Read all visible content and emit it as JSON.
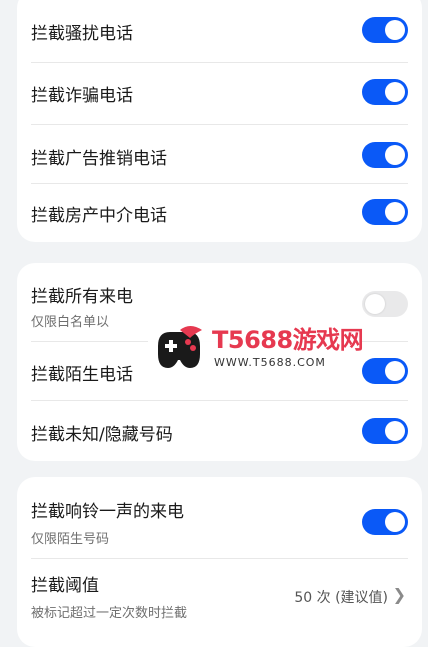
{
  "group1": {
    "items": [
      {
        "label": "拦截骚扰电话",
        "on": true
      },
      {
        "label": "拦截诈骗电话",
        "on": true
      },
      {
        "label": "拦截广告推销电话",
        "on": true
      },
      {
        "label": "拦截房产中介电话",
        "on": true
      }
    ]
  },
  "group2": {
    "items": [
      {
        "label": "拦截所有来电",
        "sub": "仅限白名单以",
        "on": false
      },
      {
        "label": "拦截陌生电话",
        "on": true
      },
      {
        "label": "拦截未知/隐藏号码",
        "on": true
      }
    ]
  },
  "group3": {
    "items": [
      {
        "label": "拦截响铃一声的来电",
        "sub": "仅限陌生号码",
        "on": true
      },
      {
        "label": "拦截阈值",
        "sub": "被标记超过一定次数时拦截",
        "value": "50 次 (建议值)"
      }
    ]
  },
  "watermark": {
    "title": "T5688游戏网",
    "url": "WWW.T5688.COM"
  },
  "colors": {
    "accent": "#0a59f7",
    "toggle_off": "#e9e9ea",
    "watermark": "#e63950"
  },
  "icons": {
    "chevron": "chevron-right-icon",
    "logo": "gamepad-logo"
  }
}
